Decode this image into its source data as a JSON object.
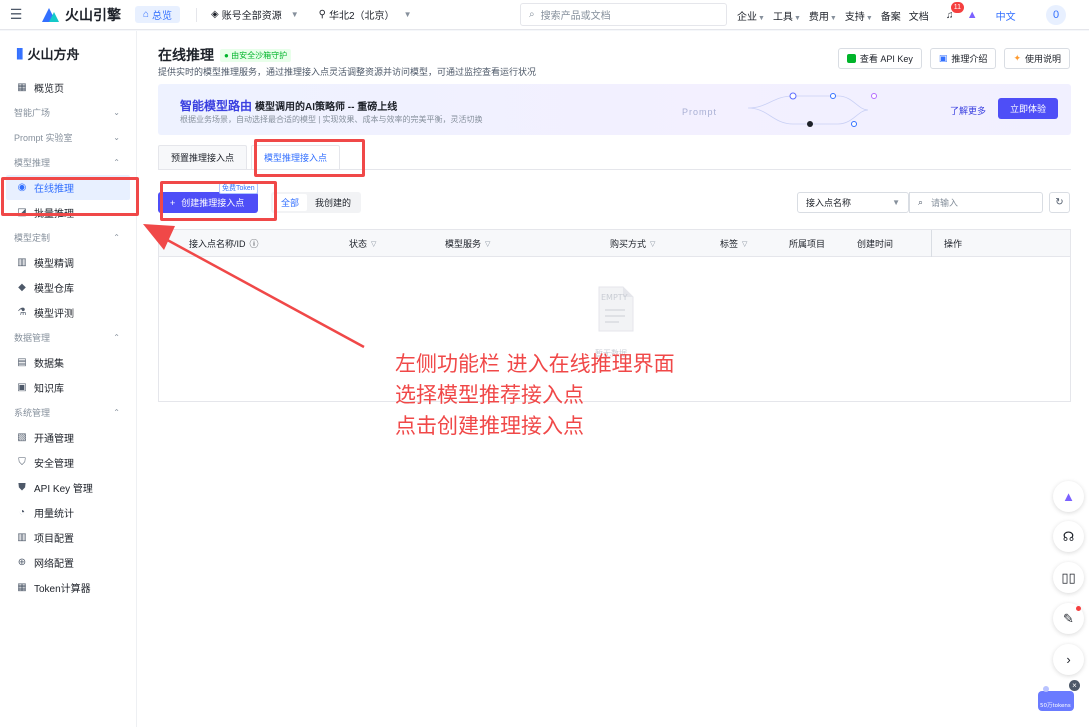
{
  "topbar": {
    "brand": "火山引擎",
    "overview": "总览",
    "account_select": "账号全部资源",
    "region_select": "华北2（北京）",
    "search_placeholder": "搜索产品或文档",
    "menu": [
      {
        "label": "企业",
        "caret": true
      },
      {
        "label": "工具",
        "caret": true
      },
      {
        "label": "费用",
        "caret": true
      },
      {
        "label": "支持",
        "caret": true
      },
      {
        "label": "备案",
        "caret": false
      },
      {
        "label": "文档",
        "caret": false
      }
    ],
    "bell_count": "11",
    "language": "中文",
    "avatar": "0"
  },
  "sidebar": {
    "title": "火山方舟",
    "items": [
      {
        "type": "item",
        "label": "概览页",
        "icon": "overview-icon",
        "glyph": "▦"
      },
      {
        "type": "group",
        "label": "智能广场"
      },
      {
        "type": "group",
        "label": "Prompt 实验室"
      },
      {
        "type": "group",
        "label": "模型推理",
        "open": true
      },
      {
        "type": "item",
        "label": "在线推理",
        "icon": "online-inference-icon",
        "glyph": "◉",
        "active": true
      },
      {
        "type": "item",
        "label": "批量推理",
        "icon": "batch-inference-icon",
        "glyph": "◪"
      },
      {
        "type": "group",
        "label": "模型定制",
        "open": true
      },
      {
        "type": "item",
        "label": "模型精调",
        "icon": "fine-tune-icon",
        "glyph": "▥"
      },
      {
        "type": "item",
        "label": "模型仓库",
        "icon": "model-repo-icon",
        "glyph": "◆"
      },
      {
        "type": "item",
        "label": "模型评测",
        "icon": "flask-icon",
        "glyph": "⚗"
      },
      {
        "type": "group",
        "label": "数据管理",
        "open": true
      },
      {
        "type": "item",
        "label": "数据集",
        "icon": "dataset-icon",
        "glyph": "▤"
      },
      {
        "type": "item",
        "label": "知识库",
        "icon": "knowledge-base-icon",
        "glyph": "▣"
      },
      {
        "type": "group",
        "label": "系统管理",
        "open": true
      },
      {
        "type": "item",
        "label": "开通管理",
        "icon": "activation-icon",
        "glyph": "▧"
      },
      {
        "type": "item",
        "label": "安全管理",
        "icon": "shield-icon",
        "glyph": "⛉"
      },
      {
        "type": "item",
        "label": "API Key 管理",
        "icon": "key-shield-icon",
        "glyph": "⛊"
      },
      {
        "type": "item",
        "label": "用量统计",
        "icon": "usage-icon",
        "glyph": "◔"
      },
      {
        "type": "item",
        "label": "项目配置",
        "icon": "project-icon",
        "glyph": "▥"
      },
      {
        "type": "item",
        "label": "网络配置",
        "icon": "globe-icon",
        "glyph": "⊕"
      },
      {
        "type": "item",
        "label": "Token计算器",
        "icon": "calculator-icon",
        "glyph": "▦"
      }
    ]
  },
  "main": {
    "title": "在线推理",
    "secure_badge": "由安全沙箱守护",
    "description": "提供实时的模型推理服务，通过推理接入点灵活调整资源并访问模型，可通过监控查看运行状况",
    "header_buttons": [
      "查看 API Key",
      "推理介绍",
      "使用说明"
    ],
    "banner": {
      "title": "智能模型路由",
      "title_suffix": "模型调用的AI策略师 -- 重磅上线",
      "subtitle": "根据业务场景，自动选择最合适的模型 | 实现效果、成本与效率的完美平衡，灵活切换",
      "prompt_label": "Prompt",
      "learn_more": "了解更多",
      "try_button": "立即体验"
    },
    "tabs": [
      {
        "label": "预置推理接入点",
        "active": false
      },
      {
        "label": "模型推理接入点",
        "active": true
      }
    ],
    "create_button": "创建推理接入点",
    "free_tag": "免费Token",
    "segment": [
      "全部",
      "我创建的"
    ],
    "filter_select": "接入点名称",
    "filter_placeholder": "请输入",
    "table": {
      "columns": [
        "接入点名称/ID",
        "状态",
        "模型服务",
        "购买方式",
        "标签",
        "所属项目",
        "创建时间",
        "操作"
      ],
      "empty_label": "EMPTY",
      "empty_text": "暂无数据"
    }
  },
  "annotation": {
    "lines": [
      "左侧功能栏 进入在线推理界面",
      "选择模型推荐接入点",
      "点击创建推理接入点"
    ],
    "color": "#f04848"
  },
  "float_buttons": [
    "ai-assistant-icon",
    "headset-icon",
    "book-icon",
    "feedback-icon",
    "chevron-right-icon"
  ],
  "promo": "50万tokens"
}
